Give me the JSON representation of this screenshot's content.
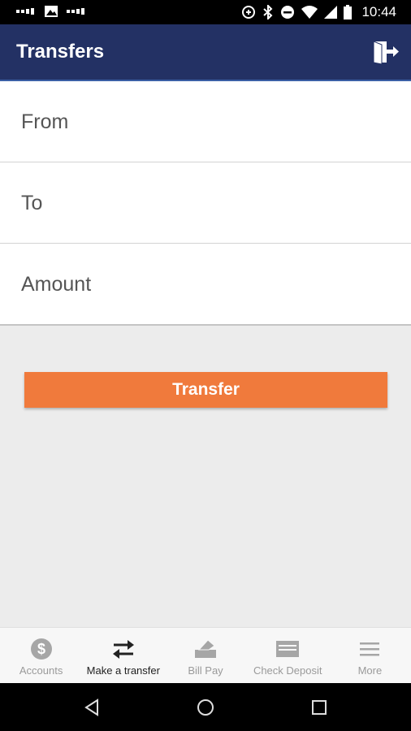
{
  "status_bar": {
    "time": "10:44"
  },
  "app_bar": {
    "title": "Transfers"
  },
  "form": {
    "fields": [
      {
        "label": "From"
      },
      {
        "label": "To"
      },
      {
        "label": "Amount"
      }
    ]
  },
  "actions": {
    "transfer_label": "Transfer"
  },
  "tab_bar": {
    "tabs": [
      {
        "label": "Accounts",
        "icon": "dollar-circle-icon"
      },
      {
        "label": "Make a transfer",
        "icon": "transfer-arrows-icon",
        "active": true
      },
      {
        "label": "Bill Pay",
        "icon": "bill-pay-icon"
      },
      {
        "label": "Check Deposit",
        "icon": "check-icon"
      },
      {
        "label": "More",
        "icon": "menu-icon"
      }
    ]
  },
  "colors": {
    "app_bar": "#233164",
    "accent": "#f07a3c",
    "background": "#ececec"
  }
}
